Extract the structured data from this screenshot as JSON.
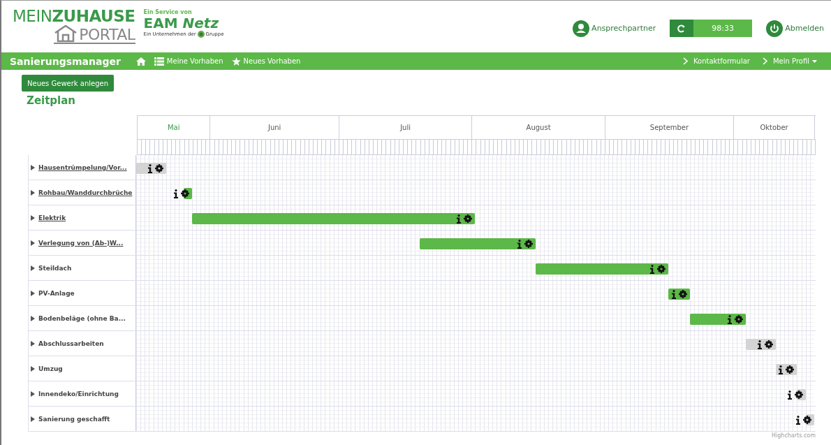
{
  "header": {
    "logo_line1": "MEIN**ZUHAUSE**",
    "logo_line2": "PORTAL",
    "service_label": "Ein Service von",
    "brand": "EAM *Netz*",
    "company_prefix": "Ein Unternehmen der",
    "company_suffix": "Gruppe",
    "contact_link": "Ansprechpartner",
    "session_timer": "98:33",
    "logout_link": "Abmelden"
  },
  "nav": {
    "title": "Sanierungsmanager",
    "items": [
      {
        "label": "Meine Vorhaben",
        "kind": "list"
      },
      {
        "label": "Neues Vorhaben",
        "kind": "star"
      }
    ],
    "right_items": [
      {
        "label": "Kontaktformular",
        "dropdown": false
      },
      {
        "label": "Mein Profil",
        "dropdown": true
      }
    ]
  },
  "new_trade_button": "Neues Gewerk anlegen",
  "section_title": "Zeitplan",
  "gantt": {
    "months": [
      "Mai",
      "Juni",
      "Juli",
      "August",
      "September",
      "Oktober"
    ],
    "tasks": [
      {
        "name": "Hausentrümpelung/Vor...",
        "link": true,
        "color": "#d4d4d4"
      },
      {
        "name": "Rohbau/Wanddurchbrüche",
        "link": true,
        "color": "#5cb848"
      },
      {
        "name": "Elektrik",
        "link": true,
        "color": "#5cb848"
      },
      {
        "name": "Verlegung von (Ab-)W...",
        "link": true,
        "color": "#5cb848"
      },
      {
        "name": "Steildach",
        "link": false,
        "color": "#5cb848"
      },
      {
        "name": "PV-Anlage",
        "link": false,
        "color": "#5cb848"
      },
      {
        "name": "Bodenbeläge (ohne Ba...",
        "link": false,
        "color": "#5cb848"
      },
      {
        "name": "Abschlussarbeiten",
        "link": false,
        "color": "#d4d4d4"
      },
      {
        "name": "Umzug",
        "link": false,
        "color": "#d4d4d4"
      },
      {
        "name": "Innendeko/Einrichtung",
        "link": false,
        "color": "#d4d4d4"
      },
      {
        "name": "Sanierung geschafft",
        "link": false,
        "color": "#d4d4d4"
      }
    ],
    "credit": "Highcharts.com"
  }
}
